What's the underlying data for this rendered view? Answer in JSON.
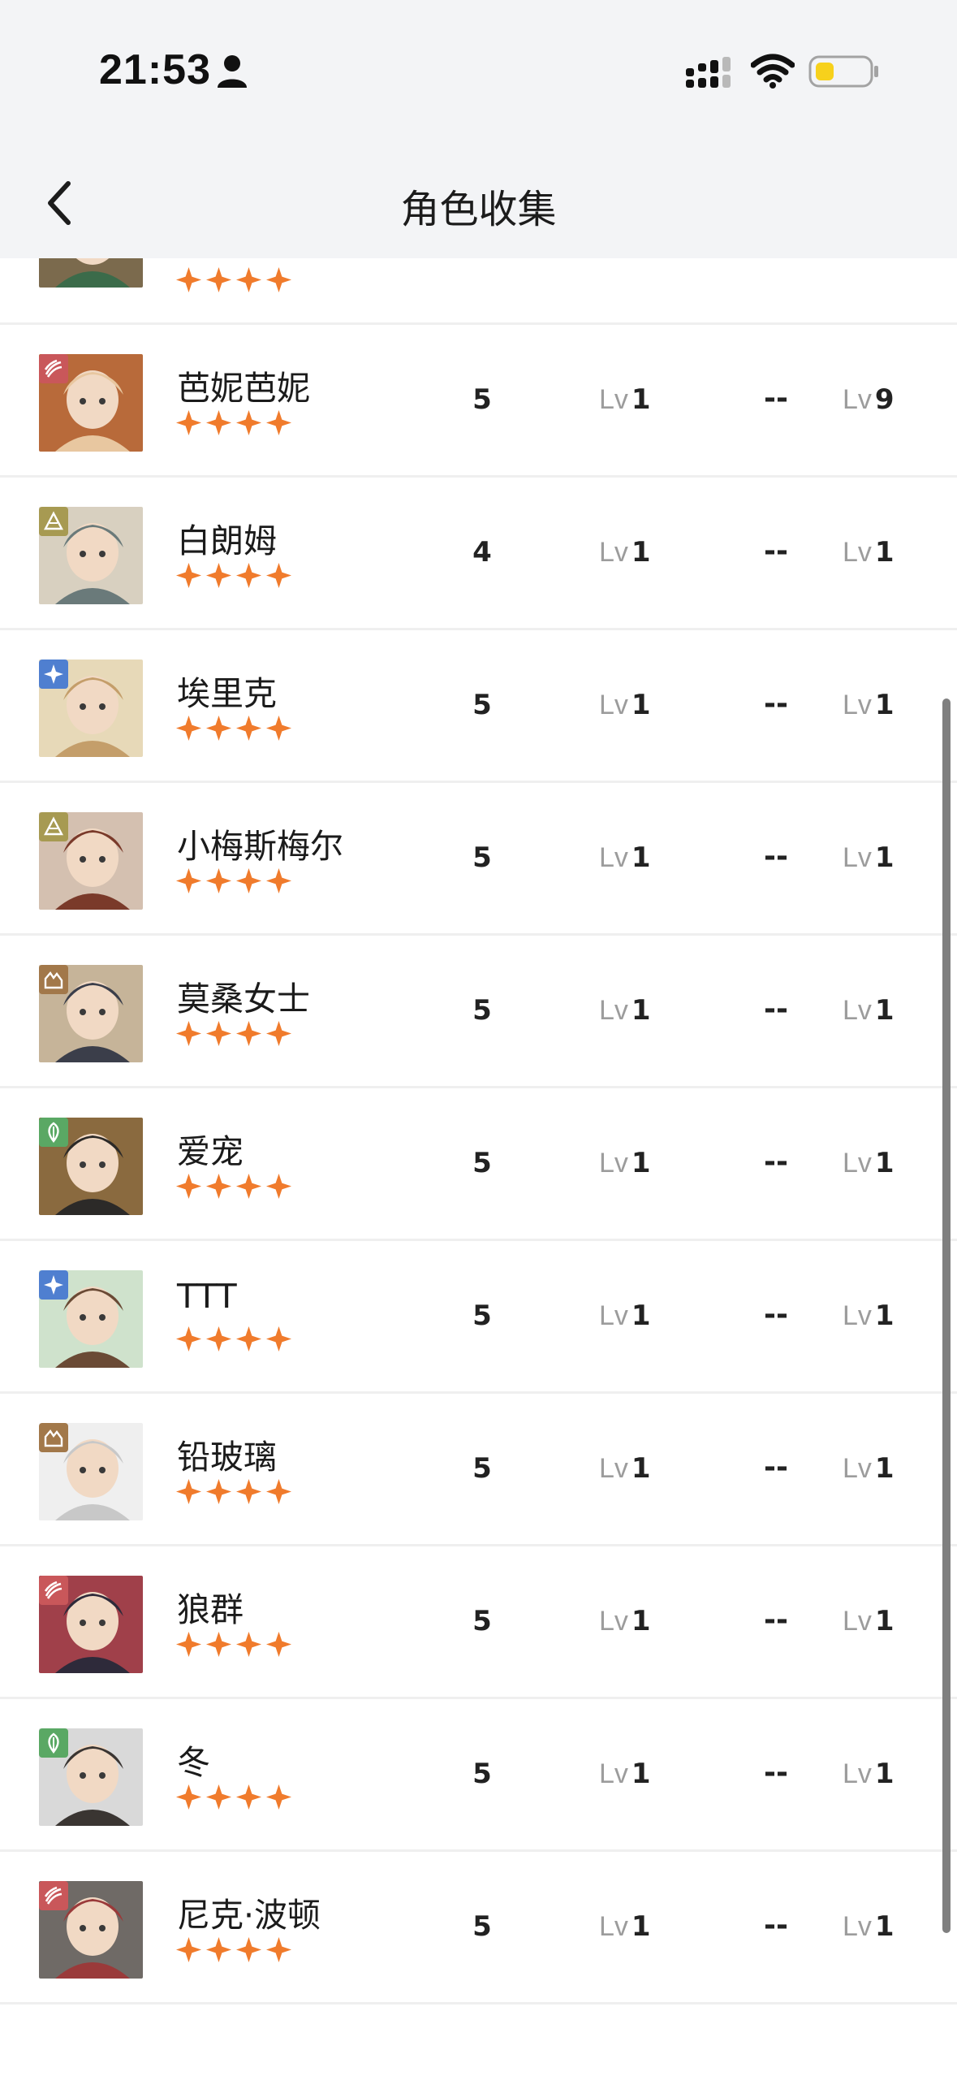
{
  "status_bar": {
    "time": "21:53",
    "icons": [
      "person-icon",
      "signal-icon",
      "wifi-icon",
      "battery-icon"
    ],
    "battery_color": "#f7d11c"
  },
  "nav": {
    "back_icon": "chevron-left-icon",
    "title": "角色收集"
  },
  "colors": {
    "star": "#f07b2c",
    "header_bg": "#f3f4f6",
    "divider": "#efefef",
    "lv_prefix": "#9c9c9c"
  },
  "lv_prefix": "Lv",
  "characters": [
    {
      "name": "",
      "stars": 4,
      "count": "",
      "lv1": "",
      "dash": "",
      "lv2": "",
      "badge": "",
      "partial": true
    },
    {
      "name": "芭妮芭妮",
      "stars": 4,
      "count": "5",
      "lv1": "1",
      "dash": "--",
      "lv2": "9",
      "badge": "claw"
    },
    {
      "name": "白朗姆",
      "stars": 4,
      "count": "4",
      "lv1": "1",
      "dash": "--",
      "lv2": "1",
      "badge": "pyramid"
    },
    {
      "name": "埃里克",
      "stars": 4,
      "count": "5",
      "lv1": "1",
      "dash": "--",
      "lv2": "1",
      "badge": "star"
    },
    {
      "name": "小梅斯梅尔",
      "stars": 4,
      "count": "5",
      "lv1": "1",
      "dash": "--",
      "lv2": "1",
      "badge": "pyramid"
    },
    {
      "name": "莫桑女士",
      "stars": 4,
      "count": "5",
      "lv1": "1",
      "dash": "--",
      "lv2": "1",
      "badge": "rock"
    },
    {
      "name": "爱宠",
      "stars": 4,
      "count": "5",
      "lv1": "1",
      "dash": "--",
      "lv2": "1",
      "badge": "leaf"
    },
    {
      "name": "TTT",
      "stars": 4,
      "count": "5",
      "lv1": "1",
      "dash": "--",
      "lv2": "1",
      "badge": "star"
    },
    {
      "name": "铅玻璃",
      "stars": 4,
      "count": "5",
      "lv1": "1",
      "dash": "--",
      "lv2": "1",
      "badge": "rock"
    },
    {
      "name": "狼群",
      "stars": 4,
      "count": "5",
      "lv1": "1",
      "dash": "--",
      "lv2": "1",
      "badge": "claw"
    },
    {
      "name": "冬",
      "stars": 4,
      "count": "5",
      "lv1": "1",
      "dash": "--",
      "lv2": "1",
      "badge": "leaf"
    },
    {
      "name": "尼克·波顿",
      "stars": 4,
      "count": "5",
      "lv1": "1",
      "dash": "--",
      "lv2": "1",
      "badge": "claw"
    }
  ]
}
